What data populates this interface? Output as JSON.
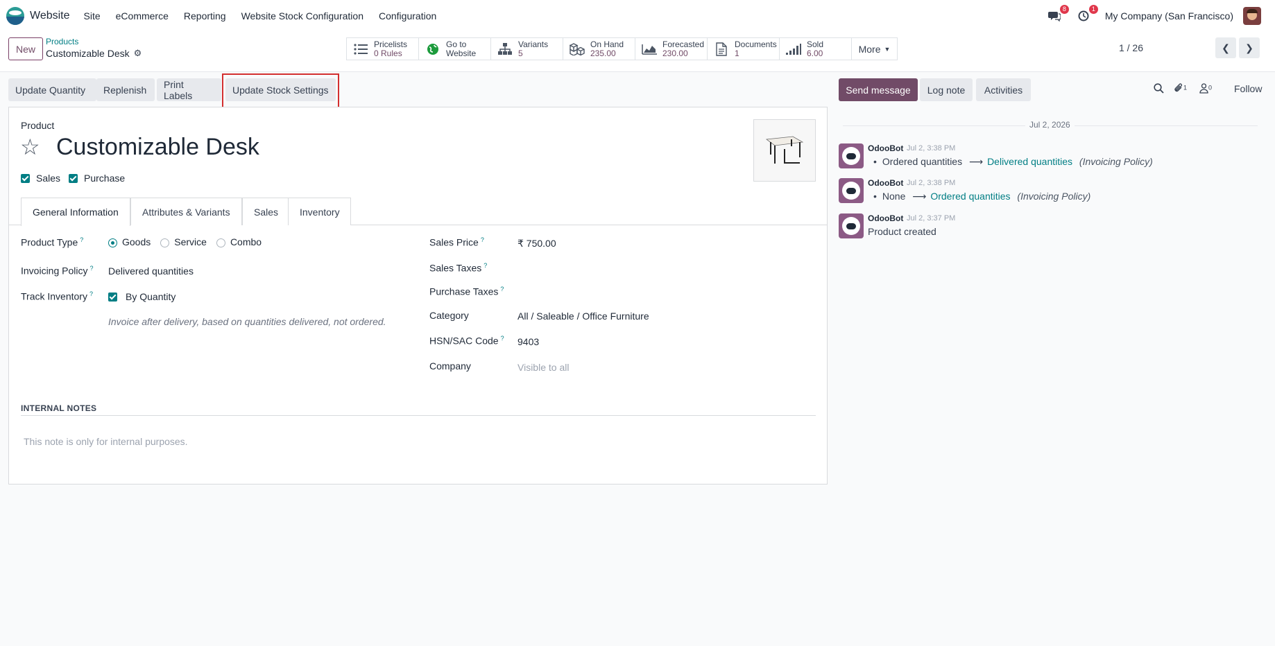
{
  "navbar": {
    "app": "Website",
    "items": [
      "Site",
      "eCommerce",
      "Reporting",
      "Website Stock Configuration",
      "Configuration"
    ],
    "messages_badge": "8",
    "activities_badge": "1",
    "company": "My Company (San Francisco)"
  },
  "control": {
    "new_label": "New",
    "breadcrumb_parent": "Products",
    "breadcrumb_current": "Customizable Desk",
    "smart_buttons": [
      {
        "label": "Pricelists",
        "value": "0  Rules"
      },
      {
        "label": "Go to",
        "value": "Website"
      },
      {
        "label": "Variants",
        "value": "5"
      },
      {
        "label": "On Hand",
        "value": "235.00"
      },
      {
        "label": "Forecasted",
        "value": "230.00"
      },
      {
        "label": "Documents",
        "value": "1"
      },
      {
        "label": "Sold",
        "value": "6.00"
      }
    ],
    "more_label": "More",
    "pager": "1 / 26"
  },
  "actions": {
    "update_quantity": "Update Quantity",
    "replenish": "Replenish",
    "print_labels": "Print Labels",
    "update_stock_settings": "Update Stock Settings"
  },
  "form": {
    "product_label": "Product",
    "name": "Customizable Desk",
    "sales_checkbox": "Sales",
    "purchase_checkbox": "Purchase",
    "tabs": [
      "General Information",
      "Attributes & Variants",
      "Sales",
      "Inventory"
    ],
    "product_type_label": "Product Type",
    "product_type_options": [
      "Goods",
      "Service",
      "Combo"
    ],
    "invoicing_policy_label": "Invoicing Policy",
    "invoicing_policy_value": "Delivered quantities",
    "track_inventory_label": "Track Inventory",
    "track_inventory_value": "By Quantity",
    "invoicing_hint": "Invoice after delivery, based on quantities delivered, not ordered.",
    "sales_price_label": "Sales Price",
    "sales_price_value": "₹ 750.00",
    "sales_taxes_label": "Sales Taxes",
    "purchase_taxes_label": "Purchase Taxes",
    "category_label": "Category",
    "category_value": "All / Saleable / Office Furniture",
    "hsn_label": "HSN/SAC Code",
    "hsn_value": "9403",
    "company_label": "Company",
    "company_placeholder": "Visible to all",
    "internal_notes_header": "INTERNAL NOTES",
    "internal_notes_placeholder": "This note is only for internal purposes."
  },
  "chatter": {
    "send_message": "Send message",
    "log_note": "Log note",
    "activities": "Activities",
    "attachments_count": "1",
    "followers_count": "0",
    "follow": "Follow",
    "date": "Jul 2, 2026",
    "messages": [
      {
        "author": "OdooBot",
        "time": "Jul 2, 3:38 PM",
        "old": "Ordered quantities",
        "new": "Delivered quantities",
        "field": "(Invoicing Policy)"
      },
      {
        "author": "OdooBot",
        "time": "Jul 2, 3:38 PM",
        "old": "None",
        "new": "Ordered quantities",
        "field": "(Invoicing Policy)"
      },
      {
        "author": "OdooBot",
        "time": "Jul 2, 3:37 PM",
        "text": "Product created"
      }
    ]
  },
  "colors": {
    "brand": "#714b67",
    "accent": "#017e84",
    "highlight": "#d32f2f",
    "badge": "#e0374b"
  }
}
